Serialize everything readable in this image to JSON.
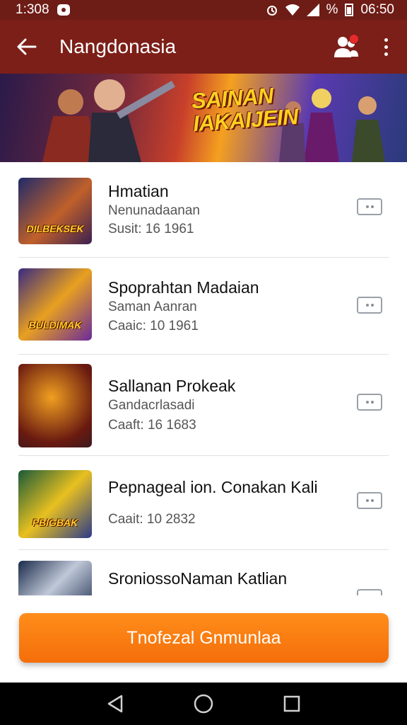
{
  "status_bar": {
    "time_left": "1:308",
    "time_right": "06:50",
    "percent_sign": "%"
  },
  "app_bar": {
    "title": "Nangdonasia",
    "back_icon": "arrow-left-icon",
    "users_icon": "users-icon",
    "menu_icon": "more-vertical-icon"
  },
  "banner": {
    "title_line1": "SAINAN",
    "title_line2": "IAKAIJEIN"
  },
  "games": [
    {
      "title": "Hmatian",
      "subtitle": "Nenunadaanan",
      "meta": "Susit: 16 1961",
      "thumb_text": "DILBEKSEK",
      "thumb_colors": [
        "#1f2a6a",
        "#c0602a",
        "#3a2050"
      ]
    },
    {
      "title": "Spoprahtan Madaian",
      "subtitle": "Saman Aanran",
      "meta": "Caaic: 10 1961",
      "thumb_text": "BULDIMAK",
      "thumb_colors": [
        "#3a2a80",
        "#e8a020",
        "#6a2a9a"
      ]
    },
    {
      "title": "Sallanan Prokeak",
      "subtitle": "Gandacrlasadi",
      "meta": "Caaft: 16 1683",
      "thumb_text": "",
      "thumb_colors": [
        "#6a1a10",
        "#f0a020",
        "#3a1a20"
      ]
    },
    {
      "title": "Pepnageal ion. Conakan Kali",
      "subtitle": "",
      "meta": "Caait: 10 2832",
      "thumb_text": "PBIGBAK",
      "thumb_colors": [
        "#1a5a3a",
        "#e8c020",
        "#2a3a8a"
      ]
    },
    {
      "title": "SroniossoNaman Katlian",
      "subtitle": "",
      "meta": "",
      "thumb_text": "",
      "thumb_colors": [
        "#1a2a4a",
        "#c0c8d8",
        "#2a3a5a"
      ]
    }
  ],
  "cta": {
    "label": "Tnofezal Gnmunlaa"
  },
  "nav_bar": {
    "back_icon": "nav-back-icon",
    "home_icon": "nav-home-icon",
    "recents_icon": "nav-recents-icon"
  }
}
